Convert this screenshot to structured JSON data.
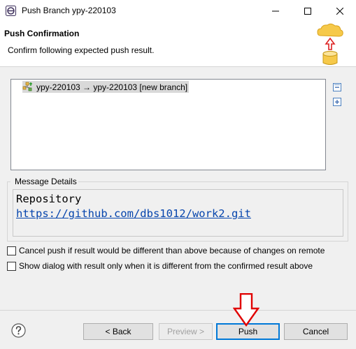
{
  "window": {
    "title": "Push Branch ypy-220103"
  },
  "banner": {
    "title": "Push Confirmation",
    "message": "Confirm following expected push result."
  },
  "tree": {
    "rows": [
      {
        "label": "ypy-220103 → ypy-220103 [new branch]",
        "icon": "push-branch-icon"
      }
    ]
  },
  "message_details": {
    "group_label": "Message Details",
    "heading": "Repository",
    "url": "https://github.com/dbs1012/work2.git"
  },
  "options": {
    "cancel_if_different": "Cancel push if result would be different than above because of changes on remote",
    "show_only_if_different": "Show dialog with result only when it is different from the confirmed result above"
  },
  "buttons": {
    "back": "< Back",
    "preview": "Preview >",
    "push": "Push",
    "cancel": "Cancel"
  },
  "colors": {
    "link": "#0645ad",
    "default_button_border": "#0078d7",
    "annotation_arrow": "#e00000"
  }
}
